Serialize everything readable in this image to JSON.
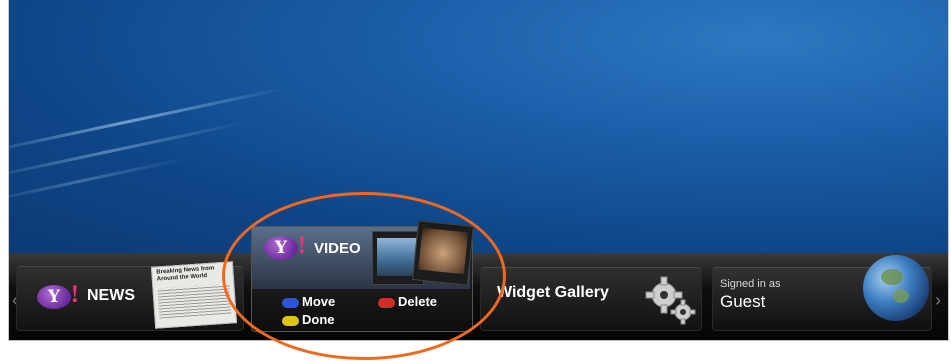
{
  "dock": {
    "news": {
      "logo_letter": "Y",
      "logo_bang": "!",
      "label": "NEWS",
      "headline": "Breaking News from Around the World"
    },
    "video": {
      "logo_letter": "Y",
      "logo_bang": "!",
      "label": "VIDEO",
      "actions": [
        {
          "label": "Move",
          "color": "#2f54d8",
          "icon": "blue-button-icon"
        },
        {
          "label": "Delete",
          "color": "#d92a2a",
          "icon": "red-button-icon"
        },
        {
          "label": "Done",
          "color": "#e0c21c",
          "icon": "yellow-button-icon"
        }
      ]
    },
    "gallery": {
      "label": "Widget Gallery",
      "icon": "gears-icon"
    },
    "profile": {
      "caption": "Signed in as",
      "user": "Guest",
      "icon": "earth-globe-icon"
    }
  },
  "colors": {
    "highlight_circle": "#f06a1e"
  }
}
